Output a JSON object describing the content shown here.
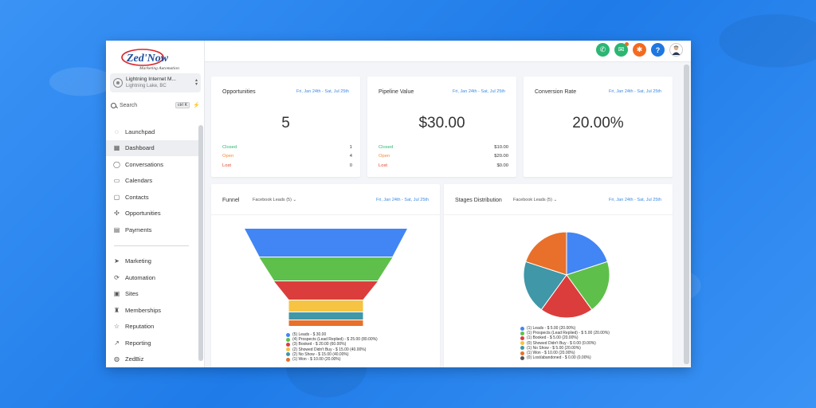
{
  "brand": {
    "logo_text": "Zed'Now",
    "tagline": "Marketing Automation"
  },
  "account": {
    "name": "Lightning Internet M...",
    "location": "Lightning Lake, BC"
  },
  "search": {
    "placeholder": "Search",
    "shortcut": "ctrl K"
  },
  "nav_primary": [
    {
      "label": "Launchpad",
      "icon": "rocket-icon"
    },
    {
      "label": "Dashboard",
      "icon": "dashboard-icon",
      "active": true
    },
    {
      "label": "Conversations",
      "icon": "chat-icon"
    },
    {
      "label": "Calendars",
      "icon": "calendar-icon"
    },
    {
      "label": "Contacts",
      "icon": "contacts-icon"
    },
    {
      "label": "Opportunities",
      "icon": "opportunities-icon"
    },
    {
      "label": "Payments",
      "icon": "payments-icon"
    }
  ],
  "nav_secondary": [
    {
      "label": "Marketing",
      "icon": "send-icon"
    },
    {
      "label": "Automation",
      "icon": "automation-icon"
    },
    {
      "label": "Sites",
      "icon": "sites-icon"
    },
    {
      "label": "Memberships",
      "icon": "memberships-icon"
    },
    {
      "label": "Reputation",
      "icon": "star-icon"
    },
    {
      "label": "Reporting",
      "icon": "reporting-icon"
    },
    {
      "label": "ZedBiz",
      "icon": "zedbiz-icon"
    }
  ],
  "topbar": {
    "icons": [
      {
        "name": "phone-icon",
        "color": "#2bb673",
        "glyph": "✆"
      },
      {
        "name": "megaphone-icon",
        "color": "#2bb673",
        "glyph": "✉"
      },
      {
        "name": "bell-icon",
        "color": "#f26b21",
        "glyph": "✱"
      },
      {
        "name": "help-icon",
        "color": "#1e78e0",
        "glyph": "?"
      }
    ]
  },
  "cards": {
    "opportunities": {
      "title": "Opportunities",
      "range": "Fri, Jan 24th - Sat, Jul 25th",
      "value": "5",
      "rows": [
        {
          "label": "Closed",
          "value": "1",
          "color": "#2bb673"
        },
        {
          "label": "Open",
          "value": "4",
          "color": "#f28c38"
        },
        {
          "label": "Lost",
          "value": "0",
          "color": "#e0452b"
        }
      ]
    },
    "pipeline": {
      "title": "Pipeline Value",
      "range": "Fri, Jan 24th - Sat, Jul 25th",
      "value": "$30.00",
      "rows": [
        {
          "label": "Closed",
          "value": "$10.00",
          "color": "#2bb673"
        },
        {
          "label": "Open",
          "value": "$20.00",
          "color": "#f28c38"
        },
        {
          "label": "Lost",
          "value": "$0.00",
          "color": "#e0452b"
        }
      ]
    },
    "conversion": {
      "title": "Conversion Rate",
      "range": "Fri, Jan 24th - Sat, Jul 25th",
      "value": "20.00%"
    },
    "funnel": {
      "title": "Funnel",
      "dropdown": "Facebook Leads (5)",
      "range": "Fri, Jan 24th - Sat, Jul 25th"
    },
    "stages": {
      "title": "Stages Distribution",
      "dropdown": "Facebook Leads (5)",
      "range": "Fri, Jan 24th - Sat, Jul 25th"
    }
  },
  "chart_data": [
    {
      "type": "funnel",
      "series": [
        {
          "label": "(5) Leads - $ 30.00",
          "count": 5,
          "color": "#4285f4"
        },
        {
          "label": "(4) Prospects (Lead Replied) - $ 25.00 (80.00%)",
          "count": 4,
          "color": "#5ec04a"
        },
        {
          "label": "(3) Booked - $ 20.00 (60.00%)",
          "count": 3,
          "color": "#db3d3d"
        },
        {
          "label": "(2) Showed Didn't Buy - $ 15.00 (40.00%)",
          "count": 2,
          "color": "#f6c343"
        },
        {
          "label": "(2) No Show - $ 15.00 (40.00%)",
          "count": 2,
          "color": "#3f97a8"
        },
        {
          "label": "(1) Won - $ 10.00 (20.00%)",
          "count": 1,
          "color": "#e8702a"
        }
      ]
    },
    {
      "type": "pie",
      "series": [
        {
          "label": "(1) Leads - $ 5.00 (20.00%)",
          "value": 20,
          "color": "#4285f4"
        },
        {
          "label": "(1) Prospects (Lead Replied) - $ 5.00 (20.00%)",
          "value": 20,
          "color": "#5ec04a"
        },
        {
          "label": "(1) Booked - $ 5.00 (20.00%)",
          "value": 20,
          "color": "#db3d3d"
        },
        {
          "label": "(0) Showed Didn't Buy - $ 0.00 (0.00%)",
          "value": 0,
          "color": "#f6c343"
        },
        {
          "label": "(1) No Show - $ 5.00 (20.00%)",
          "value": 20,
          "color": "#3f97a8"
        },
        {
          "label": "(1) Won - $ 10.00 (20.00%)",
          "value": 20,
          "color": "#e8702a"
        },
        {
          "label": "(0) Lost/abandoned - $ 0.00 (0.00%)",
          "value": 0,
          "color": "#555555"
        }
      ]
    }
  ]
}
